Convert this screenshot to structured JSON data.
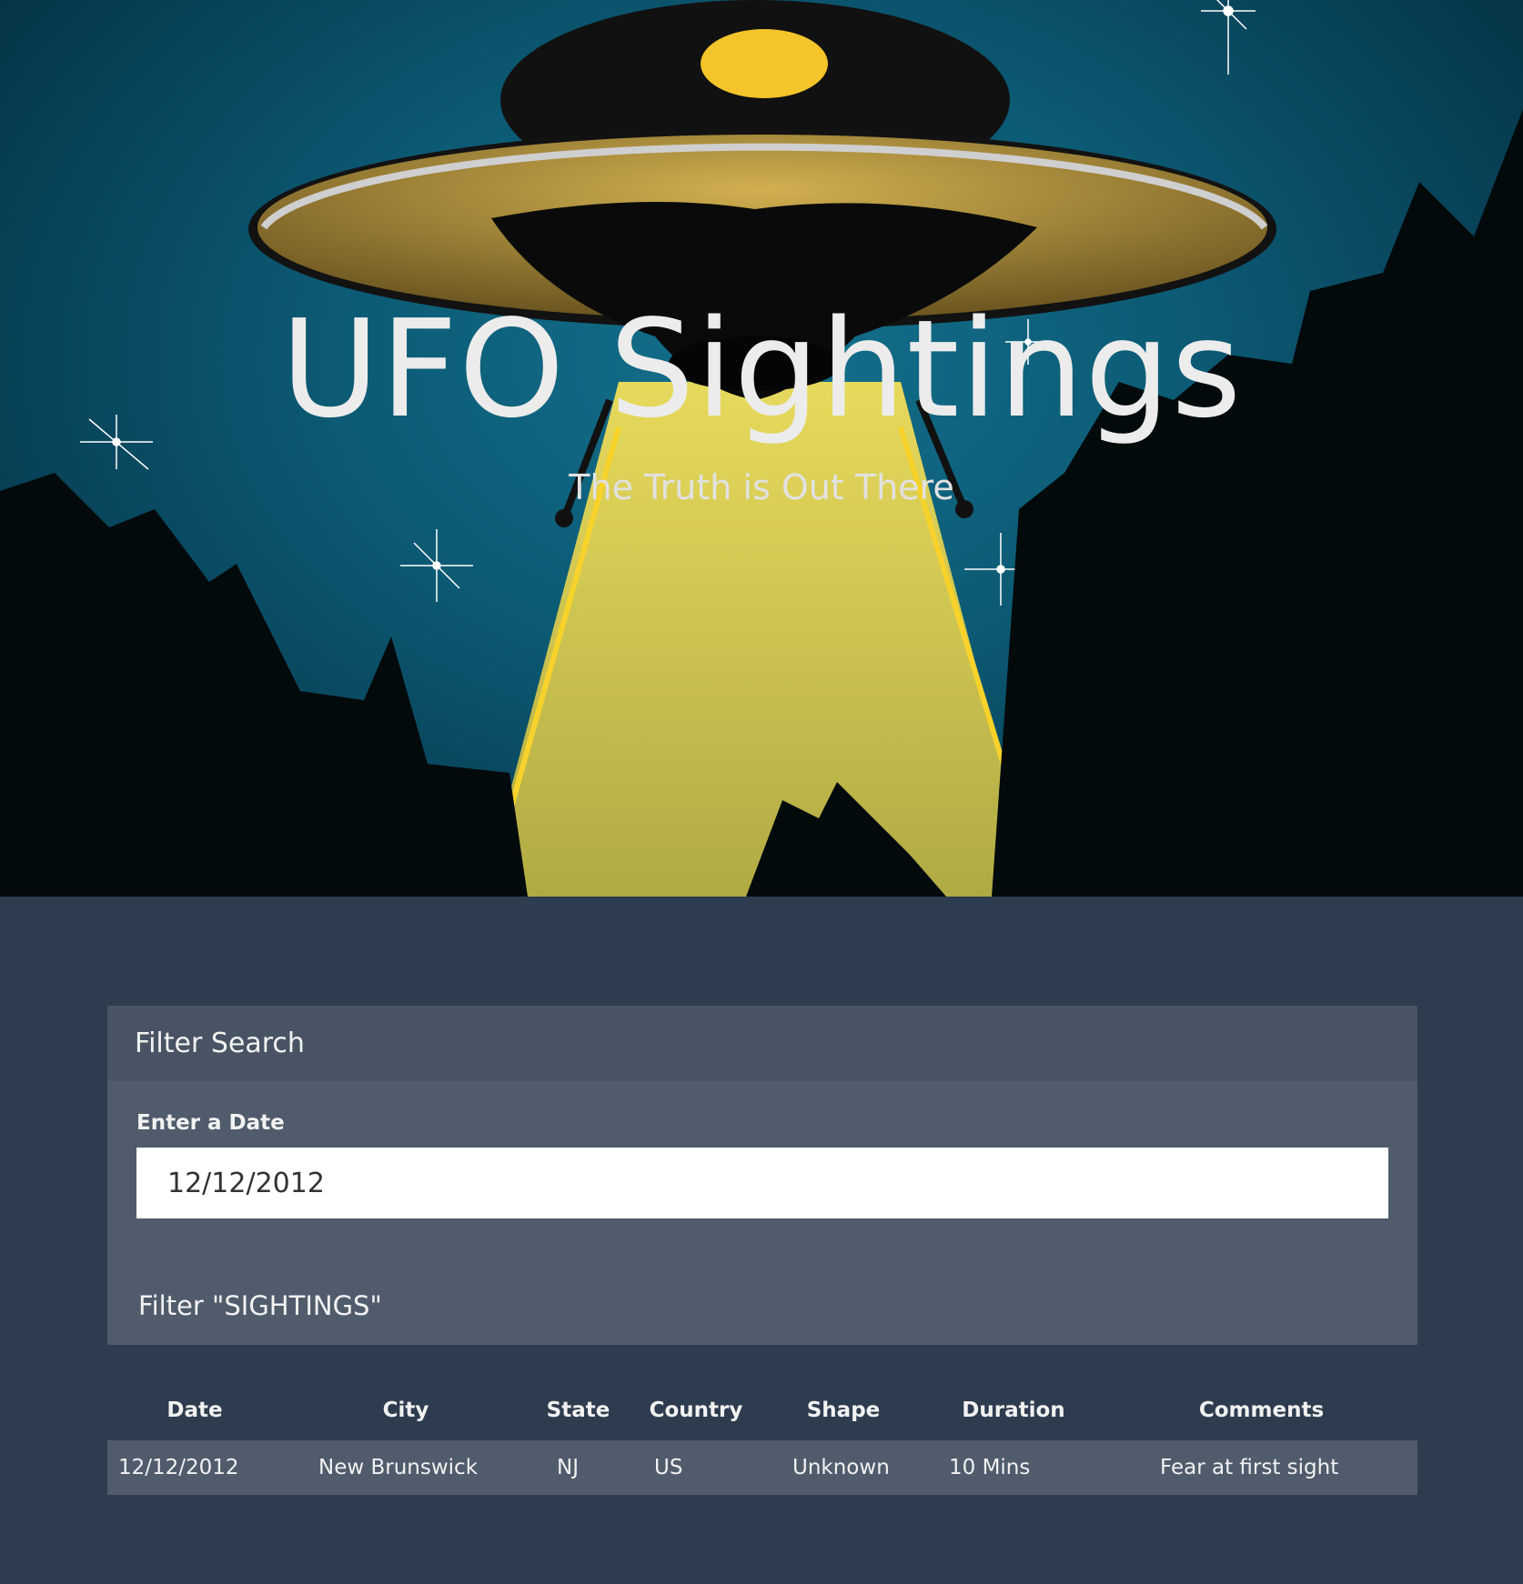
{
  "hero": {
    "title": "UFO Sightings",
    "subtitle": "The Truth is Out There"
  },
  "filter": {
    "header": "Filter Search",
    "date_label": "Enter a Date",
    "date_value": "12/12/2012",
    "button_label": "Filter \"SIGHTINGS\""
  },
  "table": {
    "headers": [
      "Date",
      "City",
      "State",
      "Country",
      "Shape",
      "Duration",
      "Comments"
    ],
    "rows": [
      [
        "12/12/2012",
        "New Brunswick",
        "NJ",
        "US",
        "Unknown",
        "10 Mins",
        "Fear at first sight"
      ]
    ]
  },
  "colors": {
    "page_bg": "#2e3c4f",
    "panel_bg": "#505c6c",
    "panel_header_bg": "#485464",
    "beam": "#e2c84a",
    "ufo_gold": "#b0902e"
  }
}
